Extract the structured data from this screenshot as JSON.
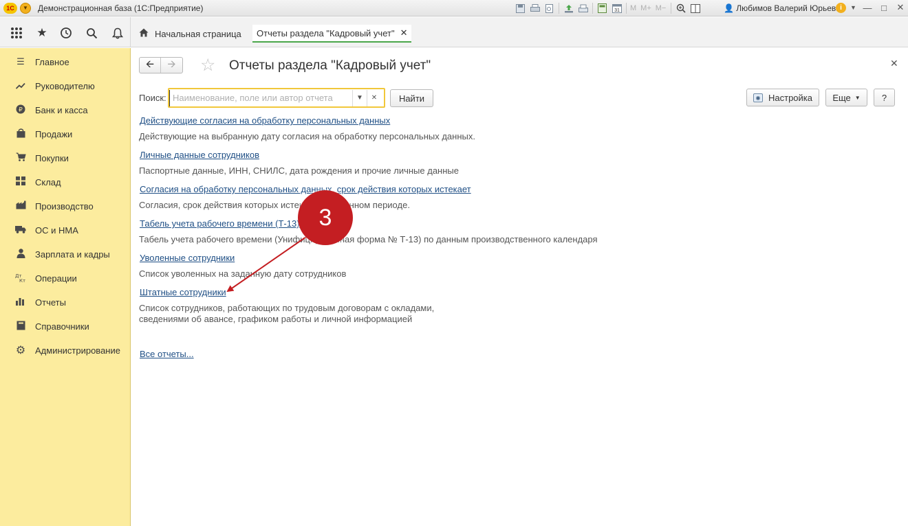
{
  "titlebar": {
    "logo": "1С",
    "app_title": "Демонстрационная база (1С:Предприятие)",
    "user": "Любимов Валерий Юрьевич",
    "icons": [
      "save-icon",
      "print-icon",
      "preview-icon",
      "upload-icon",
      "scan-icon",
      "calculator-icon",
      "calendar-icon"
    ],
    "calendar_day": "31",
    "memory_buttons": [
      "M",
      "M+",
      "M−"
    ],
    "info_glyph": "i"
  },
  "panel": {
    "tabs": [
      {
        "label": "Начальная страница"
      },
      {
        "label": "Отчеты раздела \"Кадровый учет\""
      }
    ]
  },
  "sidebar": {
    "items": [
      {
        "label": "Главное",
        "icon": "menu-lines-icon"
      },
      {
        "label": "Руководителю",
        "icon": "trend-icon"
      },
      {
        "label": "Банк и касса",
        "icon": "ruble-coin-icon"
      },
      {
        "label": "Продажи",
        "icon": "bag-icon"
      },
      {
        "label": "Покупки",
        "icon": "cart-icon"
      },
      {
        "label": "Склад",
        "icon": "warehouse-icon"
      },
      {
        "label": "Производство",
        "icon": "factory-icon"
      },
      {
        "label": "ОС и НМА",
        "icon": "truck-icon"
      },
      {
        "label": "Зарплата и кадры",
        "icon": "person-icon"
      },
      {
        "label": "Операции",
        "icon": "dt-kt-icon"
      },
      {
        "label": "Отчеты",
        "icon": "bar-chart-icon"
      },
      {
        "label": "Справочники",
        "icon": "book-icon"
      },
      {
        "label": "Администрирование",
        "icon": "gear-icon"
      }
    ]
  },
  "form": {
    "title": "Отчеты раздела \"Кадровый учет\"",
    "search_label": "Поиск:",
    "search_placeholder": "Наименование, поле или автор отчета",
    "search_value": "",
    "find_button": "Найти",
    "settings_button": "Настройка",
    "more_button": "Еще",
    "help_button": "?",
    "reports": [
      {
        "title": "Действующие согласия на обработку персональных данных",
        "description": [
          "Действующие на выбранную дату согласия на обработку персональных данных."
        ]
      },
      {
        "title": "Личные данные сотрудников",
        "description": [
          "Паспортные данные, ИНН, СНИЛС, дата рождения и прочие личные данные"
        ]
      },
      {
        "title": "Согласия на обработку персональных данных, срок действия которых истекает",
        "description": [
          "Согласия, срок действия которых истекает в указанном периоде."
        ]
      },
      {
        "title": "Табель учета рабочего времени (Т-13)",
        "description": [
          "Табель учета рабочего времени (Унифицированная форма № Т-13) по данным производственного календаря"
        ]
      },
      {
        "title": "Уволенные сотрудники",
        "description": [
          "Список уволенных на заданную дату сотрудников"
        ]
      },
      {
        "title": "Штатные сотрудники",
        "description": [
          "Список сотрудников, работающих по трудовым договорам с окладами,",
          "сведениями об авансе, графиком работы и личной информацией"
        ]
      }
    ],
    "all_reports_link": "Все отчеты..."
  },
  "annotation": {
    "step_number": "3",
    "color": "#c41e22"
  }
}
